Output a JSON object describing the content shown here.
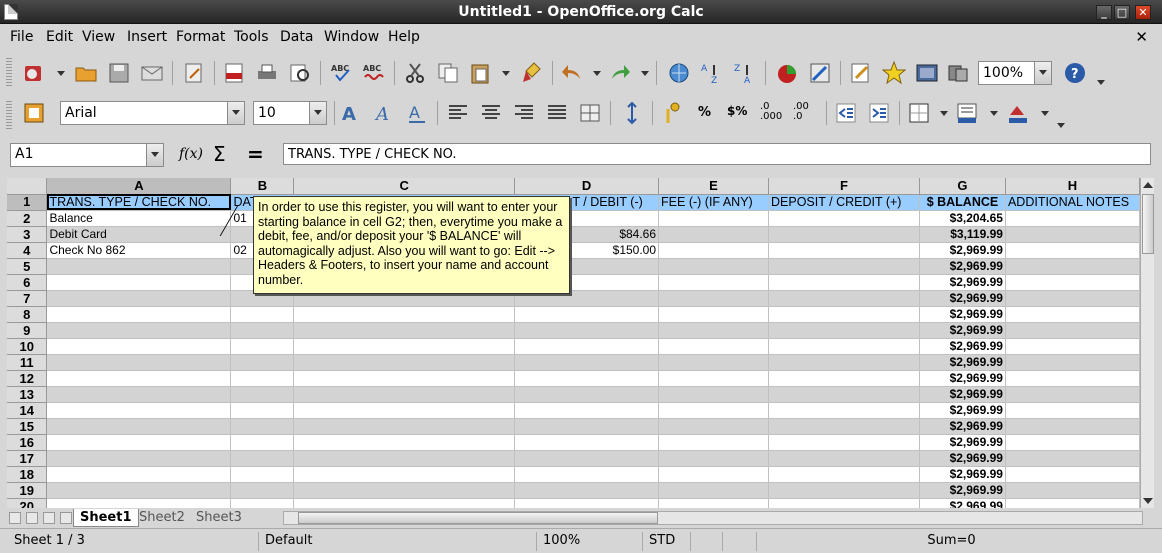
{
  "window": {
    "title": "Untitled1 - OpenOffice.org Calc"
  },
  "menu": [
    "File",
    "Edit",
    "View",
    "Insert",
    "Format",
    "Tools",
    "Data",
    "Window",
    "Help"
  ],
  "toolbar": {
    "zoom": "100%",
    "font_name": "Arial",
    "font_size": "10"
  },
  "formula": {
    "cell_ref": "A1",
    "content": "TRANS. TYPE / CHECK NO."
  },
  "columns": [
    "A",
    "B",
    "C",
    "D",
    "E",
    "F",
    "G",
    "H"
  ],
  "header_row": [
    "TRANS. TYPE / CHECK NO.",
    "DAT",
    "",
    "T / DEBIT (-)",
    "FEE (-) (IF ANY)",
    "DEPOSIT / CREDIT (+)",
    "$ BALANCE",
    "ADDITIONAL NOTES"
  ],
  "rows": [
    {
      "a": "Balance",
      "b": "01",
      "d": "",
      "g": "$3,204.65"
    },
    {
      "a": "Debit Card",
      "b": "",
      "d": "$84.66",
      "g": "$3,119.99"
    },
    {
      "a": "Check No 862",
      "b": "02",
      "d": "$150.00",
      "g": "$2,969.99"
    },
    {
      "a": "",
      "b": "",
      "d": "",
      "g": "$2,969.99"
    },
    {
      "a": "",
      "b": "",
      "d": "",
      "g": "$2,969.99"
    },
    {
      "a": "",
      "b": "",
      "d": "",
      "g": "$2,969.99"
    },
    {
      "a": "",
      "b": "",
      "d": "",
      "g": "$2,969.99"
    },
    {
      "a": "",
      "b": "",
      "d": "",
      "g": "$2,969.99"
    },
    {
      "a": "",
      "b": "",
      "d": "",
      "g": "$2,969.99"
    },
    {
      "a": "",
      "b": "",
      "d": "",
      "g": "$2,969.99"
    },
    {
      "a": "",
      "b": "",
      "d": "",
      "g": "$2,969.99"
    },
    {
      "a": "",
      "b": "",
      "d": "",
      "g": "$2,969.99"
    },
    {
      "a": "",
      "b": "",
      "d": "",
      "g": "$2,969.99"
    },
    {
      "a": "",
      "b": "",
      "d": "",
      "g": "$2,969.99"
    },
    {
      "a": "",
      "b": "",
      "d": "",
      "g": "$2,969.99"
    },
    {
      "a": "",
      "b": "",
      "d": "",
      "g": "$2,969.99"
    },
    {
      "a": "",
      "b": "",
      "d": "",
      "g": "$2,969.99"
    },
    {
      "a": "",
      "b": "",
      "d": "",
      "g": "$2,969.99"
    },
    {
      "a": "",
      "b": "",
      "d": "",
      "g": "$2,969.99"
    }
  ],
  "comment": "In order to use this register, you will want to enter your starting balance in cell G2; then, everytime you make a debit, fee, and/or deposit your '$ BALANCE' will automagically adjust. Also you will want to go: Edit --> Headers & Footers, to insert your name and account number.",
  "sheets": [
    "Sheet1",
    "Sheet2",
    "Sheet3"
  ],
  "status": {
    "sheet": "Sheet 1 / 3",
    "style": "Default",
    "zoom": "100%",
    "mode": "STD",
    "sum": "Sum=0"
  },
  "colors": {
    "header_fill": "#99ccff",
    "comment_fill": "#ffffc0",
    "alt_row": "#d3d3d3"
  }
}
